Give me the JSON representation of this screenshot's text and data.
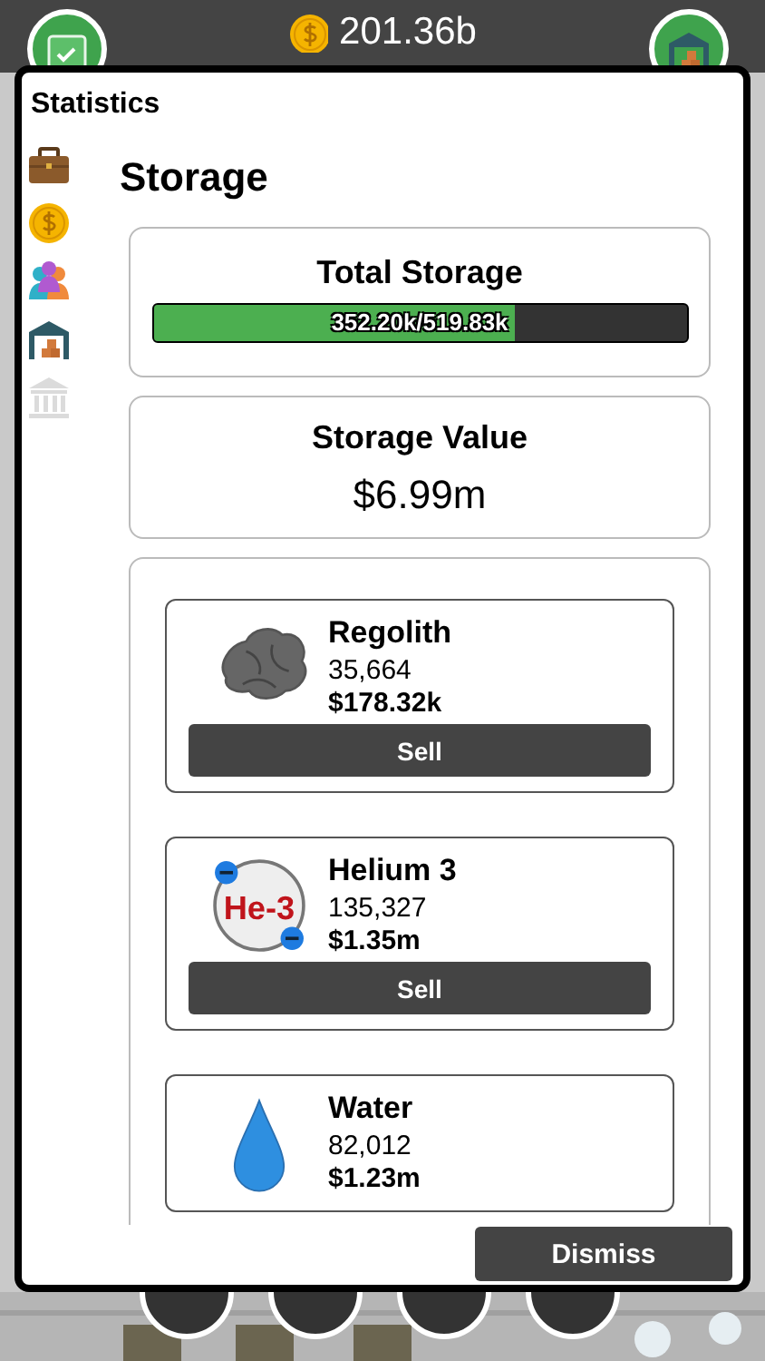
{
  "top_bar": {
    "balance": "201.36b",
    "left_button": {
      "kind": "calendar"
    },
    "right_button": {
      "kind": "warehouse"
    }
  },
  "dialog": {
    "title": "Statistics",
    "sidebar": {
      "items": [
        {
          "kind": "briefcase",
          "disabled": false
        },
        {
          "kind": "coin",
          "disabled": false
        },
        {
          "kind": "people",
          "disabled": false
        },
        {
          "kind": "warehouse",
          "disabled": false
        },
        {
          "kind": "bank",
          "disabled": true
        }
      ]
    },
    "heading": "Storage",
    "total_storage": {
      "title": "Total Storage",
      "level": 0.6775,
      "reading": "352.20k/519.83k"
    },
    "storage_value": {
      "title": "Storage Value",
      "value": "$6.99m"
    },
    "resources": [
      {
        "kind": "regolith",
        "name": "Regolith",
        "amount": "35,664",
        "value": "$178.32k",
        "sell_button": "Sell"
      },
      {
        "kind": "helium3",
        "icon_label": "He-3",
        "name": "Helium 3",
        "amount": "135,327",
        "value": "$1.35m",
        "sell_button": "Sell"
      },
      {
        "kind": "water",
        "name": "Water",
        "amount": "82,012",
        "value": "$1.23m"
      }
    ],
    "dismiss_button": "Dismiss"
  },
  "bottom_bar": {
    "buttons": [
      {
        "kind": "round"
      },
      {
        "kind": "round"
      },
      {
        "kind": "round"
      },
      {
        "kind": "round"
      }
    ]
  }
}
